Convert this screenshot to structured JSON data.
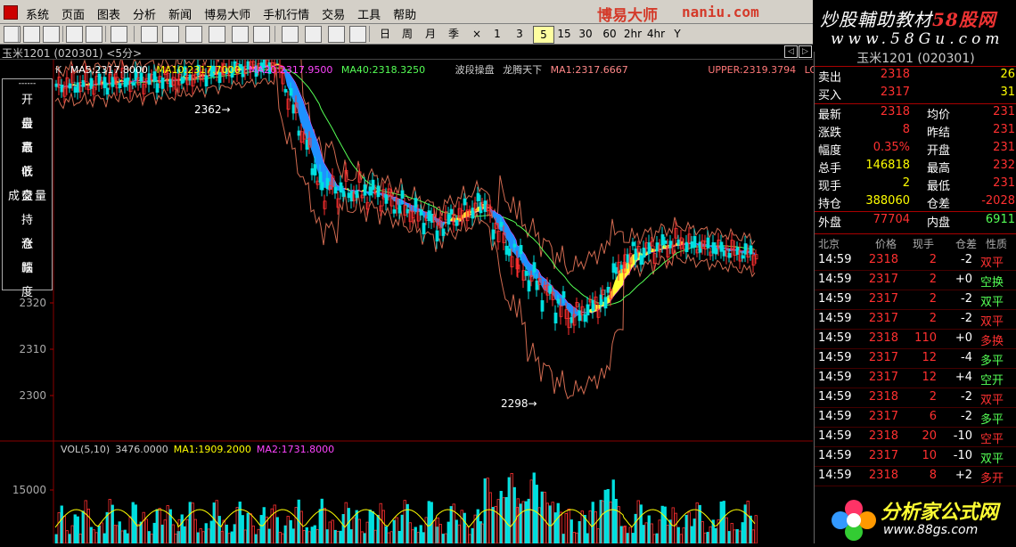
{
  "menu": {
    "items": [
      "系统",
      "页面",
      "图表",
      "分析",
      "新闻",
      "博易大师",
      "手机行情",
      "交易",
      "工具",
      "帮助"
    ]
  },
  "brand": {
    "name": "博易大师",
    "domain": "naniu.com"
  },
  "brand_right": {
    "line1_a": "炒股輔助教材",
    "line1_b": "58股网",
    "line2": "www.58Gu.com"
  },
  "toolbar": {
    "periods": [
      "日",
      "周",
      "月",
      "季",
      "×",
      "1",
      "3",
      "5",
      "15",
      "30",
      "60",
      "2hr",
      "4hr",
      "Y"
    ],
    "active_period": "5"
  },
  "title": {
    "text": "玉米1201 (020301) <5分>"
  },
  "ma_legend": {
    "k": "K",
    "ma5": "MA5:2317.8000",
    "ma10": "MA10:2317.7000",
    "ma20": "MA20:2317.9500",
    "ma40": "MA40:2318.3250",
    "indicator1": "波段操盘",
    "indicator2": "龙腾天下",
    "ma1": "MA1:2317.6667",
    "upper": "UPPER:2319.3794",
    "lo": "LO"
  },
  "colors": {
    "ma5": "#ffffff",
    "ma10": "#ffff00",
    "ma20": "#ff44ff",
    "ma40": "#55ff55",
    "ma1": "#ff8888",
    "upper": "#ff7777",
    "vol_ma1": "#ffff00",
    "vol_ma2": "#ff44ff",
    "up": "#ff3030",
    "down": "#00e0e0",
    "band": "#d06a50"
  },
  "info_labels": [
    "开盘",
    "最高",
    "最低",
    "收盘",
    "成交量",
    "持仓",
    "涨跌",
    "幅度"
  ],
  "price_axis": {
    "labels": [
      "2320",
      "2310",
      "2300"
    ]
  },
  "annotations": {
    "high": "2362",
    "low": "2298"
  },
  "vol_legend": {
    "vol": "VOL(5,10)",
    "vol_value": "3476.0000",
    "ma1": "MA1:1909.2000",
    "ma2": "MA2:1731.8000"
  },
  "vol_axis": {
    "label": "15000"
  },
  "quote": {
    "title": "玉米1201 (020301)",
    "sell": {
      "label": "卖出",
      "price": "2318",
      "vol": "26"
    },
    "buy": {
      "label": "买入",
      "price": "2317",
      "vol": "31"
    },
    "rows": [
      {
        "l1": "最新",
        "v1": "2318",
        "c1": "#ff3030",
        "l2": "均价",
        "v2": "231"
      },
      {
        "l1": "涨跌",
        "v1": "8",
        "c1": "#ff3030",
        "l2": "昨结",
        "v2": "231"
      },
      {
        "l1": "幅度",
        "v1": "0.35%",
        "c1": "#ff3030",
        "l2": "开盘",
        "v2": "231"
      },
      {
        "l1": "总手",
        "v1": "146818",
        "c1": "#ffff00",
        "l2": "最高",
        "v2": "232"
      },
      {
        "l1": "现手",
        "v1": "2",
        "c1": "#ffff00",
        "l2": "最低",
        "v2": "231"
      },
      {
        "l1": "持仓",
        "v1": "388060",
        "c1": "#ffff00",
        "l2": "仓差",
        "v2": "-2028"
      }
    ],
    "outer": {
      "label": "外盘",
      "value": "77704"
    },
    "inner": {
      "label": "内盘",
      "value": "6911"
    }
  },
  "ticks_header": [
    "北京",
    "价格",
    "现手",
    "仓差",
    "性质"
  ],
  "ticks": [
    {
      "time": "14:59",
      "price": "2318",
      "vol": "2",
      "chg": "-2",
      "type": "双平",
      "pc": "#ff3030",
      "tc": "#ff3030"
    },
    {
      "time": "14:59",
      "price": "2317",
      "vol": "2",
      "chg": "+0",
      "type": "空换",
      "pc": "#ff3030",
      "tc": "#55ff55"
    },
    {
      "time": "14:59",
      "price": "2317",
      "vol": "2",
      "chg": "-2",
      "type": "双平",
      "pc": "#ff3030",
      "tc": "#55ff55"
    },
    {
      "time": "14:59",
      "price": "2317",
      "vol": "2",
      "chg": "-2",
      "type": "双平",
      "pc": "#ff3030",
      "tc": "#ff3030"
    },
    {
      "time": "14:59",
      "price": "2318",
      "vol": "110",
      "chg": "+0",
      "type": "多换",
      "pc": "#ff3030",
      "tc": "#ff3030"
    },
    {
      "time": "14:59",
      "price": "2317",
      "vol": "12",
      "chg": "-4",
      "type": "多平",
      "pc": "#ff3030",
      "tc": "#55ff55"
    },
    {
      "time": "14:59",
      "price": "2317",
      "vol": "12",
      "chg": "+4",
      "type": "空开",
      "pc": "#ff3030",
      "tc": "#55ff55"
    },
    {
      "time": "14:59",
      "price": "2318",
      "vol": "2",
      "chg": "-2",
      "type": "双平",
      "pc": "#ff3030",
      "tc": "#ff3030"
    },
    {
      "time": "14:59",
      "price": "2317",
      "vol": "6",
      "chg": "-2",
      "type": "多平",
      "pc": "#ff3030",
      "tc": "#55ff55"
    },
    {
      "time": "14:59",
      "price": "2318",
      "vol": "20",
      "chg": "-10",
      "type": "空平",
      "pc": "#ff3030",
      "tc": "#ff3030"
    },
    {
      "time": "14:59",
      "price": "2317",
      "vol": "10",
      "chg": "-10",
      "type": "双平",
      "pc": "#ff3030",
      "tc": "#55ff55"
    },
    {
      "time": "14:59",
      "price": "2318",
      "vol": "8",
      "chg": "+2",
      "type": "多开",
      "pc": "#ff3030",
      "tc": "#ff3030"
    }
  ],
  "watermark": {
    "line1": "分析家公式网",
    "line2": "www.88gs.com"
  }
}
